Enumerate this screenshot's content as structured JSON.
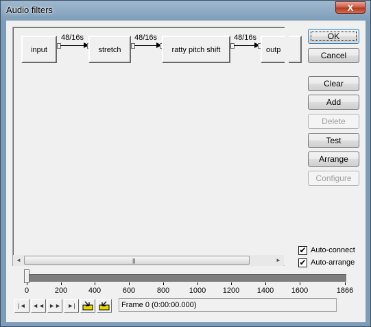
{
  "window": {
    "title": "Audio filters",
    "close_glyph": "X"
  },
  "graph": {
    "nodes": [
      {
        "label": "input"
      },
      {
        "label": "stretch"
      },
      {
        "label": "ratty pitch shift"
      },
      {
        "label": "outp"
      }
    ],
    "connections": [
      {
        "label": "48/16s"
      },
      {
        "label": "48/16s"
      },
      {
        "label": "48/16s"
      }
    ]
  },
  "scrollbar": {
    "left_arrow": "◄",
    "right_arrow": "►",
    "grip": "|||"
  },
  "buttons": {
    "ok": "OK",
    "cancel": "Cancel",
    "clear": "Clear",
    "add": "Add",
    "delete": "Delete",
    "test": "Test",
    "arrange": "Arrange",
    "configure": "Configure"
  },
  "options": {
    "auto_connect": {
      "label": "Auto-connect",
      "checked": true
    },
    "auto_arrange": {
      "label": "Auto-arrange",
      "checked": true
    },
    "check_glyph": "✔"
  },
  "timeline": {
    "position": 0,
    "max": 1866,
    "ticks": [
      "0",
      "200",
      "400",
      "600",
      "800",
      "1000",
      "1200",
      "1400",
      "1600",
      "1866"
    ]
  },
  "transport": {
    "start_icon": "|◄",
    "prev_icon": "◄◄",
    "next_icon": "►►",
    "end_icon": "►|",
    "mark_in_icon": "mark-in",
    "mark_out_icon": "mark-out"
  },
  "status": {
    "frame_text": "Frame 0 (0:00:00.000)"
  }
}
